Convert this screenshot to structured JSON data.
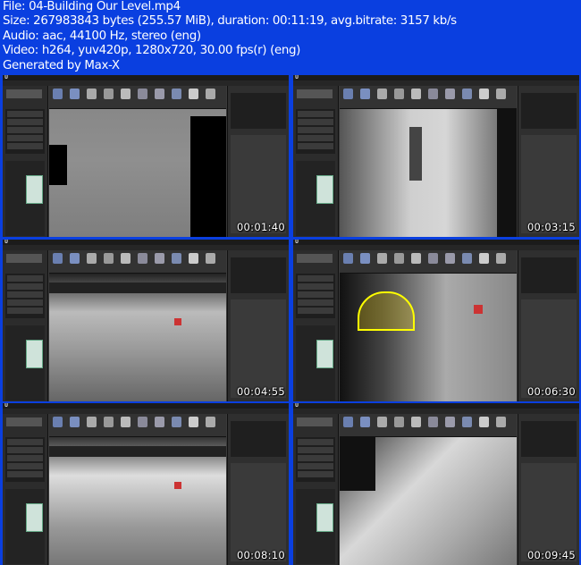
{
  "header": {
    "file": "File: 04-Building Our Level.mp4",
    "size": "Size: 267983843 bytes (255.57 MiB), duration: 00:11:19, avg.bitrate: 3157 kb/s",
    "audio": "Audio: aac, 44100 Hz, stereo (eng)",
    "video": "Video: h264, yuv420p, 1280x720, 30.00 fps(r) (eng)",
    "generator": "Generated by Max-X"
  },
  "colors": {
    "background": "#0a3fe0",
    "header_text": "#ffffff"
  },
  "thumbnails": [
    {
      "timestamp": "00:01:40"
    },
    {
      "timestamp": "00:03:15"
    },
    {
      "timestamp": "00:04:55"
    },
    {
      "timestamp": "00:06:30"
    },
    {
      "timestamp": "00:08:10"
    },
    {
      "timestamp": "00:09:45"
    }
  ]
}
